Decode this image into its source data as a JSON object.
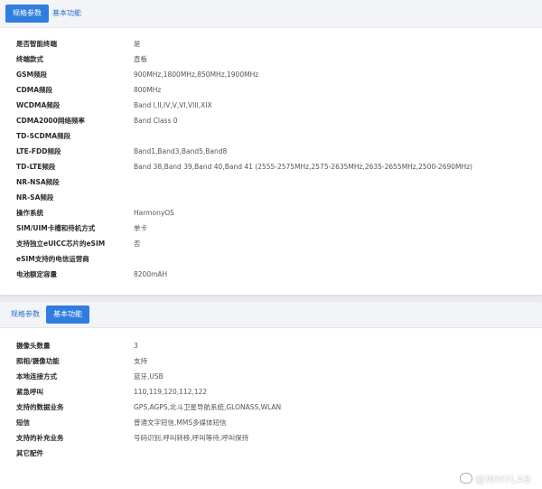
{
  "panel1": {
    "tabs": [
      {
        "label": "规格参数",
        "active": true
      },
      {
        "label": "基本功能",
        "active": false
      }
    ],
    "rows": [
      {
        "key": "是否智能终端",
        "value": "是"
      },
      {
        "key": "终端款式",
        "value": "直板"
      },
      {
        "key": "GSM频段",
        "value": "900MHz,1800MHz,850MHz,1900MHz"
      },
      {
        "key": "CDMA频段",
        "value": "800MHz"
      },
      {
        "key": "WCDMA频段",
        "value": "Band I,II,IV,V,VI,VIII,XIX"
      },
      {
        "key": "CDMA2000网络频率",
        "value": "Band Class 0"
      },
      {
        "key": "TD-SCDMA频段",
        "value": ""
      },
      {
        "key": "LTE-FDD频段",
        "value": "Band1,Band3,Band5,Band8"
      },
      {
        "key": "TD-LTE频段",
        "value": "Band 38,Band 39,Band 40,Band 41 (2555-2575MHz,2575-2635MHz,2635-2655MHz,2500-2690MHz)"
      },
      {
        "key": "NR-NSA频段",
        "value": ""
      },
      {
        "key": "NR-SA频段",
        "value": ""
      },
      {
        "key": "操作系统",
        "value": "HarmonyOS"
      },
      {
        "key": "SIM/UIM卡槽和待机方式",
        "value": "单卡"
      },
      {
        "key": "支持独立eUICC芯片的eSIM",
        "value": "否"
      },
      {
        "key": "eSIM支持的电信运营商",
        "value": ""
      },
      {
        "key": "电池额定容量",
        "value": "8200mAH"
      }
    ]
  },
  "panel2": {
    "tabs": [
      {
        "label": "规格参数",
        "active": false
      },
      {
        "label": "基本功能",
        "active": true
      }
    ],
    "rows": [
      {
        "key": "摄像头数量",
        "value": "3"
      },
      {
        "key": "照相/摄像功能",
        "value": "支持"
      },
      {
        "key": "本地连接方式",
        "value": "蓝牙,USB"
      },
      {
        "key": "紧急呼叫",
        "value": "110,119,120,112,122"
      },
      {
        "key": "支持的数据业务",
        "value": "GPS,AGPS,北斗卫星导航系统,GLONASS,WLAN"
      },
      {
        "key": "短信",
        "value": "普通文字短信,MMS多媒体短信"
      },
      {
        "key": "支持的补充业务",
        "value": "号码识别,呼叫转移,呼叫等待,呼叫保持"
      },
      {
        "key": "其它配件",
        "value": ""
      }
    ]
  },
  "watermark": {
    "text": "@WHYLAB"
  }
}
